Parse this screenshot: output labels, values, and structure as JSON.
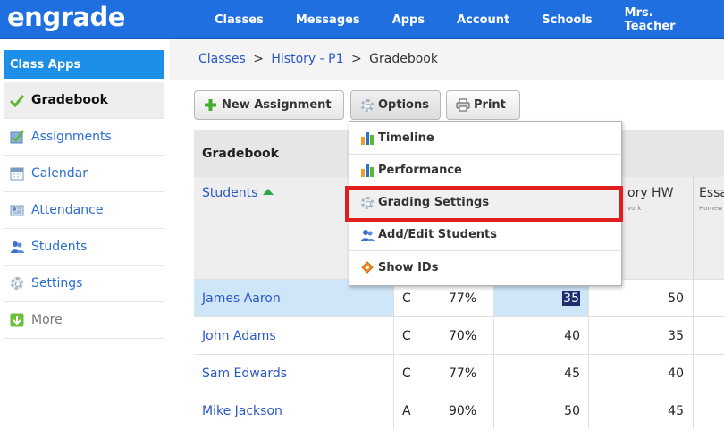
{
  "app": {
    "logo": "engrade"
  },
  "topnav": [
    "Classes",
    "Messages",
    "Apps",
    "Account",
    "Schools",
    "Mrs. Teacher"
  ],
  "sidebar": {
    "header": "Class Apps",
    "items": [
      {
        "label": "Gradebook",
        "icon": "checkmark-icon",
        "active": true
      },
      {
        "label": "Assignments",
        "icon": "assignments-icon"
      },
      {
        "label": "Calendar",
        "icon": "calendar-icon"
      },
      {
        "label": "Attendance",
        "icon": "attendance-icon"
      },
      {
        "label": "Students",
        "icon": "students-icon"
      },
      {
        "label": "Settings",
        "icon": "gear-icon"
      },
      {
        "label": "More",
        "icon": "download-arrow-icon"
      }
    ]
  },
  "breadcrumb": {
    "classes": "Classes",
    "history": "History - P1",
    "current": "Gradebook",
    "sep": ">"
  },
  "toolbar": {
    "new_assignment": "New Assignment",
    "options": "Options",
    "print": "Print"
  },
  "gradebook": {
    "title": "Gradebook",
    "students_header": "Students",
    "columns": [
      {
        "title": "ory HW",
        "subtitle": "vork"
      },
      {
        "title": "Essa",
        "subtitle": "Homew"
      }
    ],
    "rows": [
      {
        "name": "James Aaron",
        "grade": "C",
        "percent": "77%",
        "s1": "35",
        "s2": "50",
        "selected": true
      },
      {
        "name": "John Adams",
        "grade": "C",
        "percent": "70%",
        "s1": "40",
        "s2": "35"
      },
      {
        "name": "Sam Edwards",
        "grade": "C",
        "percent": "77%",
        "s1": "45",
        "s2": "40"
      },
      {
        "name": "Mike Jackson",
        "grade": "A",
        "percent": "90%",
        "s1": "50",
        "s2": "45"
      }
    ]
  },
  "options_menu": {
    "items": [
      "Timeline",
      "Performance",
      "Grading Settings",
      "Add/Edit Students",
      "Show IDs"
    ],
    "highlighted": "Grading Settings"
  },
  "colors": {
    "brand_blue": "#1f6fe0",
    "sidebar_header": "#1e8fe8",
    "highlight_red": "#e01e1e",
    "link": "#2a58c8"
  }
}
